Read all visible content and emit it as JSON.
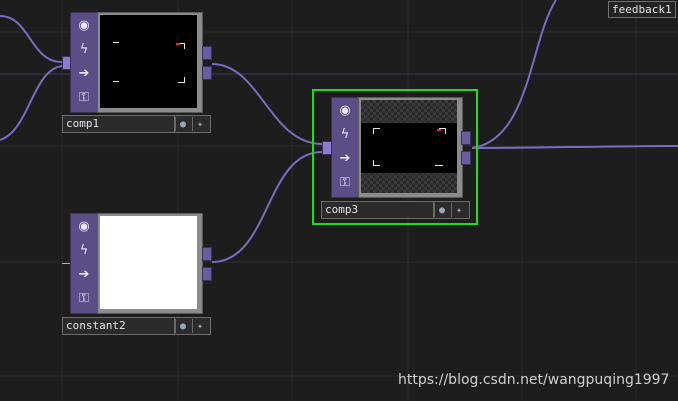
{
  "colors": {
    "background": "#1d1d1d",
    "grid_line": "#2c2c2c",
    "wire": "#7a6bc2",
    "node_bar": "#5b4e86",
    "selection": "#1fdc1f"
  },
  "nodes": {
    "comp1": {
      "name": "comp1",
      "viewer": "black-composite-with-corner-marks"
    },
    "comp3": {
      "name": "comp3",
      "viewer": "checker-composite-with-corner-marks",
      "selected": true
    },
    "constant2": {
      "name": "constant2",
      "viewer": "white-constant"
    }
  },
  "node_buttons": [
    "viewer-toggle-icon",
    "cook-icon",
    "pass-through-icon",
    "lock-icon"
  ],
  "feedback_tag": "feedback1",
  "watermark": "https://blog.csdn.net/wangpuqing1997"
}
